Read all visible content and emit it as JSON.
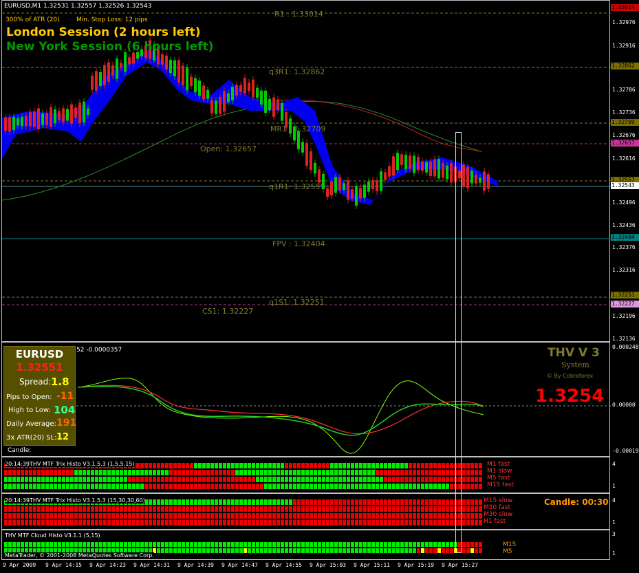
{
  "window": {
    "title": "EURUSD,M1  1.32531 1.32557 1.32526 1.32543"
  },
  "indicator_line": {
    "atr": "300% of ATR (20)",
    "stop_loss": "Min. Stop Loss:   12 pips"
  },
  "sessions": {
    "london": "London Session (2 hours left)",
    "new_york": "New York Session (6 hours left)"
  },
  "levels": {
    "r1": "R1 : 1.33014",
    "q3r1": "q3R1: 1.32862",
    "mr1": "MR1 : 1.32709",
    "open": "Open: 1.32657",
    "q1r1": "q1R1: 1.32555",
    "fpv": "FPV : 1.32404",
    "q1s1": "q1S1: 1.32251",
    "cs1": "CS1: 1.32227"
  },
  "price_axis": {
    "ticks": [
      "1.33046",
      "1.32976",
      "1.32916",
      "1.32856",
      "1.32786",
      "1.32736",
      "1.32676",
      "1.32616",
      "1.32556",
      "1.32496",
      "1.32436",
      "1.32376",
      "1.32316",
      "1.32256",
      "1.32196",
      "1.32136"
    ],
    "tags": [
      {
        "text": "1.33014",
        "bg": "#cc0000",
        "fg": "#000"
      },
      {
        "text": "1.32862",
        "bg": "#7a7000",
        "fg": "#000"
      },
      {
        "text": "1.32709",
        "bg": "#7a7000",
        "fg": "#000"
      },
      {
        "text": "1.32657",
        "bg": "#cc3399",
        "fg": "#000"
      },
      {
        "text": "1.32557",
        "bg": "#7a7000",
        "fg": "#000"
      },
      {
        "text": "1.32543",
        "bg": "#ffffff",
        "fg": "#000"
      },
      {
        "text": "1.32404",
        "bg": "#008080",
        "fg": "#000"
      },
      {
        "text": "1.32251",
        "bg": "#7a7000",
        "fg": "#000"
      },
      {
        "text": "1.32227",
        "bg": "#dd99dd",
        "fg": "#000"
      }
    ]
  },
  "info_box": {
    "symbol": "EURUSD",
    "price": "1.32551",
    "spread_label": "Spread:",
    "spread_value": "1.8",
    "pips_open_label": "Pips to Open:",
    "pips_open_value": "-11",
    "high_low_label": "High to Low:",
    "high_low_value": "104",
    "daily_avg_label": "Daily Average:",
    "daily_avg_value": "191",
    "atr_label": "3x ATR(20) SL:",
    "atr_value": "12",
    "candle_label": "Candle:"
  },
  "osc_pane": {
    "header": "52 -0.0000357",
    "brand": "THV V 3",
    "system": "System",
    "by": "© By Cobraforex",
    "big_price": "1.3254",
    "ticks": [
      "0.000248",
      "0.00000",
      "-0.000196"
    ]
  },
  "histo1": {
    "title": "20:14:39THV MTF Trix Histo V3.1.5.3 (1,5,5,15)",
    "labels": [
      "M1 fast",
      "M1 slow",
      "M5 fast",
      "M15 fast"
    ],
    "ticks": [
      "4",
      "1"
    ]
  },
  "histo2": {
    "title": "20:14:39THV MTF Trix Histo V3.1.5.3 (15,30,30,60)",
    "labels": [
      "M15 slow",
      "M30 fast",
      "M30 slow",
      "H1 fast"
    ],
    "candle": "Candle:  00:30",
    "ticks": [
      "4",
      "1"
    ]
  },
  "histo3": {
    "title": "THV MTF Cloud Histo V3.1.1 (5,15)",
    "labels": [
      "M15",
      "M5"
    ],
    "ticks": [
      "3",
      "1"
    ]
  },
  "copyright": "MetaTrader, © 2001-2008 MetaQuotes Software Corp.",
  "time_axis": [
    "9 Apr 2009",
    "9 Apr 14:15",
    "9 Apr 14:23",
    "9 Apr 14:31",
    "9 Apr 14:39",
    "9 Apr 14:47",
    "9 Apr 14:55",
    "9 Apr 15:03",
    "9 Apr 15:11",
    "9 Apr 15:19",
    "9 Apr 15:27"
  ],
  "colors": {
    "bull": "#00cc00",
    "bear": "#dd2222",
    "cloud": "#0000ee",
    "level": "#807a30",
    "green_hist": "#00ee00",
    "red_hist": "#ee0000",
    "yellow_hist": "#ffff00"
  }
}
